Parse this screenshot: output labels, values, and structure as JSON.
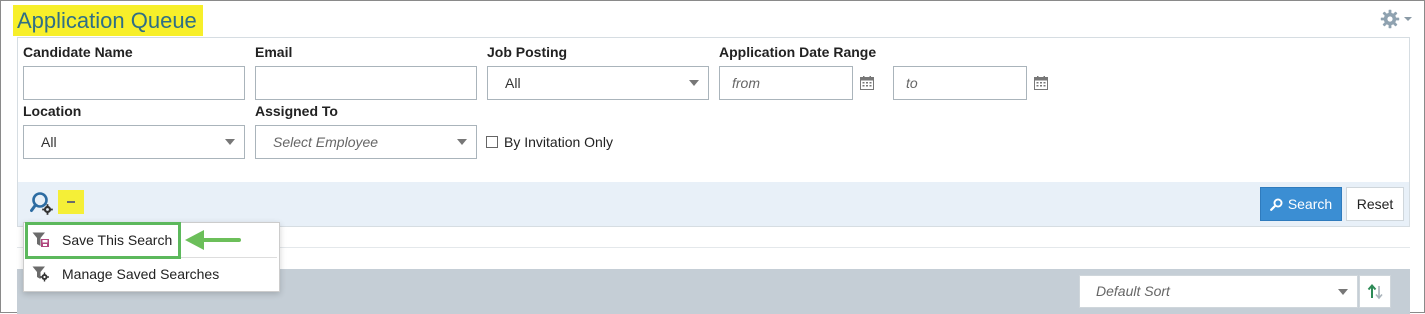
{
  "header": {
    "title": "Application Queue",
    "settings_icon": "gear-icon"
  },
  "filters": {
    "candidate_name": {
      "label": "Candidate Name",
      "value": "",
      "placeholder": ""
    },
    "email": {
      "label": "Email",
      "value": "",
      "placeholder": ""
    },
    "job_posting": {
      "label": "Job Posting",
      "value": "All"
    },
    "date_range": {
      "label": "Application Date Range",
      "from_placeholder": "from",
      "to_placeholder": "to"
    },
    "location": {
      "label": "Location",
      "value": "All"
    },
    "assigned_to": {
      "label": "Assigned To",
      "placeholder": "Select Employee"
    },
    "by_invitation": {
      "label": "By Invitation Only",
      "checked": false
    }
  },
  "actions": {
    "search_label": "Search",
    "reset_label": "Reset"
  },
  "saved_search_menu": {
    "items": [
      {
        "label": "Save This Search",
        "icon": "save-filter-icon"
      },
      {
        "label": "Manage Saved Searches",
        "icon": "manage-filter-icon"
      }
    ]
  },
  "sort": {
    "placeholder": "Default Sort"
  },
  "colors": {
    "title": "#2f6f86",
    "highlight": "#f7ef2a",
    "search_button": "#3b8ed3",
    "annotation": "#5cb85c",
    "band": "#c5ced6",
    "action_bar": "#e8f0f8"
  }
}
